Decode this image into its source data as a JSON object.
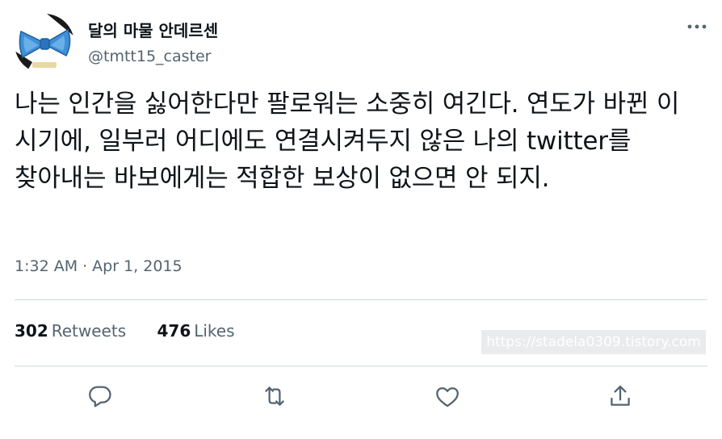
{
  "author": {
    "display_name": "달의 마물 안데르센",
    "handle": "@tmtt15_caster",
    "avatar_icon": "blue-bow-tie-avatar"
  },
  "menu": {
    "icon": "more-horizontal-icon"
  },
  "tweet": {
    "text": "나는 인간을 싫어한다만 팔로워는 소중히 여긴다. 연도가 바뀐 이 시기에, 일부러 어디에도 연결시켜두지 않은 나의 twitter를 찾아내는 바보에게는 적합한 보상이 없으면 안 되지.",
    "time": "1:32 AM",
    "separator": "·",
    "date": "Apr 1, 2015"
  },
  "stats": {
    "retweets_count": "302",
    "retweets_label": "Retweets",
    "likes_count": "476",
    "likes_label": "Likes"
  },
  "watermark": {
    "text": "https://stadela0309.tistory.com"
  },
  "actions": [
    {
      "icon": "reply-icon"
    },
    {
      "icon": "retweet-icon"
    },
    {
      "icon": "like-icon"
    },
    {
      "icon": "share-icon"
    }
  ],
  "colors": {
    "text_primary": "#0f1419",
    "text_secondary": "#536471",
    "divider": "#cfd9de",
    "icon": "#536471",
    "bow_blue": "#3e8fd8"
  }
}
